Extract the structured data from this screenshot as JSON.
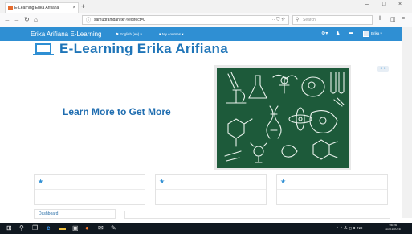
{
  "browser": {
    "tab_title": "E-Learning Erika Arifiana",
    "tab_close": "×",
    "new_tab": "+",
    "window_controls": [
      "–",
      "□",
      "×"
    ],
    "nav": {
      "back": "←",
      "forward": "→",
      "reload": "↻",
      "home": "⌂"
    },
    "url": "samudramdah.tk/?redirect=0",
    "url_actions": "··· ⛉ ☆",
    "search_placeholder": "Search",
    "toolbar_icons": [
      "⫴",
      "◫",
      "≡"
    ]
  },
  "site": {
    "brand": "Erika Arifiana E-Learning",
    "language_menu": "English (en) ▾",
    "courses_menu": "My courses ▾",
    "user_name": "Erika ▾",
    "header_icons": [
      "⚙▾",
      "♟",
      "▬"
    ],
    "page_title": "E-Learning Erika Arifiana",
    "hero_text": "Learn More to Get More",
    "slider_control": "● ●"
  },
  "cards": [
    {
      "star": "★"
    },
    {
      "star": "★"
    },
    {
      "star": "★"
    }
  ],
  "dashboard_label": "Dashboard",
  "taskbar": {
    "icons": [
      "⊞",
      "⚲",
      "❐",
      "e",
      "▬",
      "▣",
      "●",
      "✉",
      "✎"
    ],
    "tray": "⌃ ⌃ ⁂ ◫ ⧖ IND",
    "time": "06:26",
    "date": "11/01/2016"
  },
  "colors": {
    "header_blue": "#2f8fd3",
    "title_blue": "#1f75b8",
    "chalkboard_green": "#1d5a3a",
    "taskbar": "#101820"
  }
}
